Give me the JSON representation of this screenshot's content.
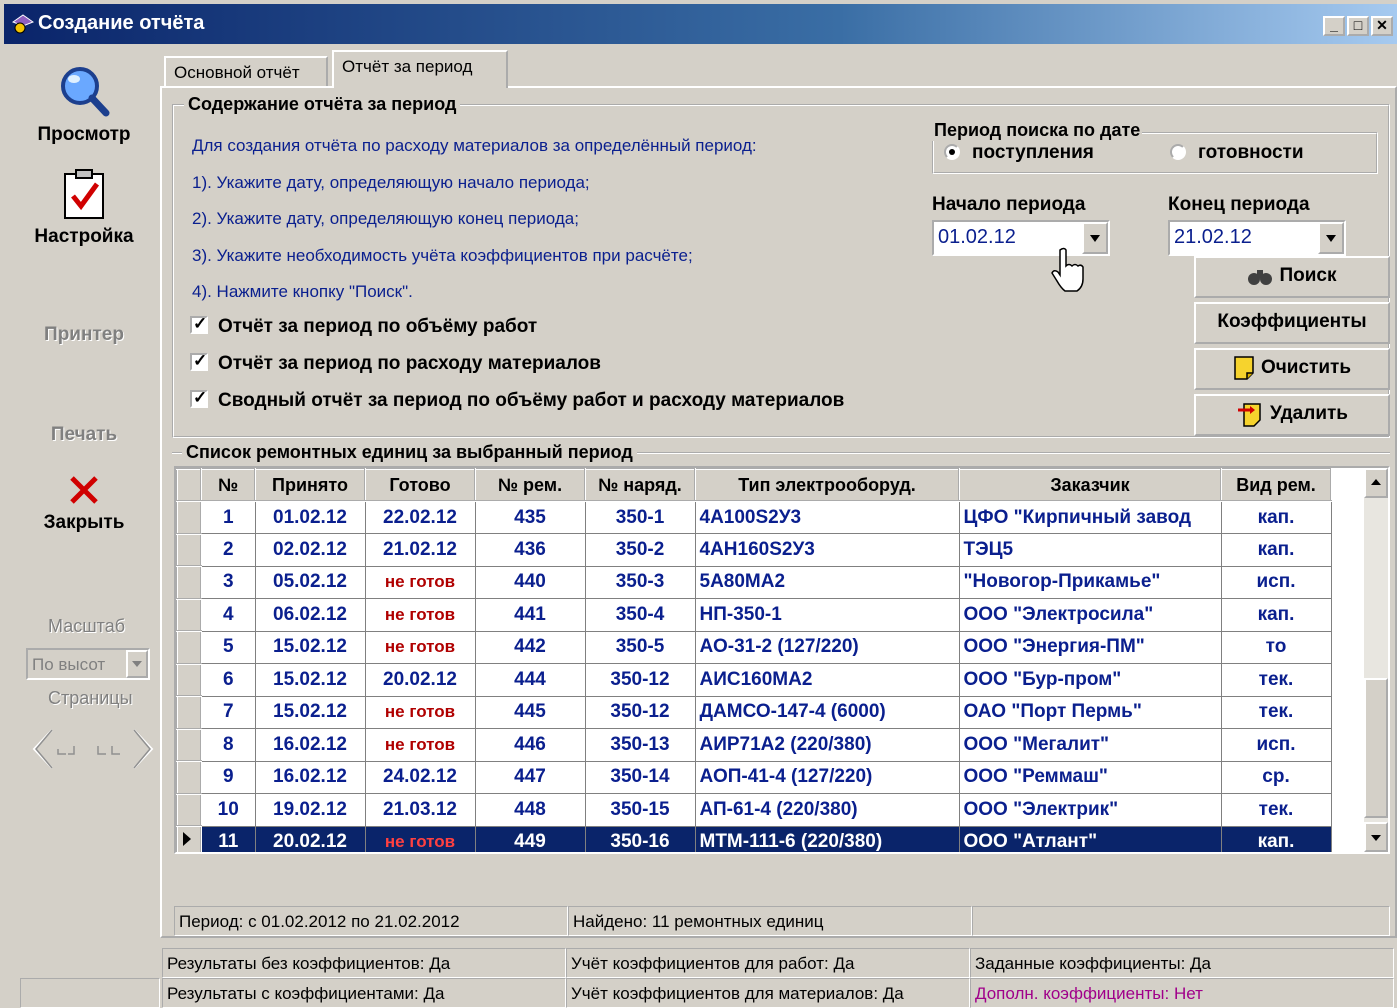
{
  "window": {
    "title": "Создание отчёта"
  },
  "left_toolbar": {
    "view": "Просмотр",
    "settings": "Настройка",
    "printer": "Принтер",
    "print": "Печать",
    "close": "Закрыть",
    "scale_label": "Масштаб",
    "scale_value": "По высот",
    "pages_label": "Страницы"
  },
  "tabs": [
    "Основной отчёт",
    "Отчёт за период"
  ],
  "content_group": {
    "title": "Содержание отчёта за период",
    "instructions": [
      "Для создания отчёта по расходу материалов за определённый период:",
      "1). Укажите дату, определяющую начало периода;",
      "2). Укажите дату, определяющую конец периода;",
      "3). Укажите необходимость учёта коэффициентов при расчёте;",
      "4). Нажмите кнопку \"Поиск\"."
    ],
    "checkboxes": [
      {
        "label": "Отчёт за период по объёму работ",
        "checked": true
      },
      {
        "label": "Отчёт за период по расходу материалов",
        "checked": true
      },
      {
        "label": "Сводный отчёт за период по объёму работ и расходу материалов",
        "checked": true
      }
    ]
  },
  "period_group": {
    "title": "Период поиска по дате",
    "radio_receipt": "поступления",
    "radio_ready": "готовности",
    "selected": "поступления"
  },
  "start_label": "Начало периода",
  "start_value": "01.02.12",
  "end_label": "Конец периода",
  "end_value": "21.02.12",
  "buttons": {
    "search": "Поиск",
    "coefficients": "Коэффициенты",
    "clear": "Очистить",
    "delete": "Удалить"
  },
  "list_group": {
    "title": "Список ремонтных единиц за выбранный период"
  },
  "table": {
    "columns": [
      "№",
      "Принято",
      "Готово",
      "№ рем.",
      "№ наряд.",
      "Тип электрооборуд.",
      "Заказчик",
      "Вид рем."
    ],
    "rows": [
      [
        "1",
        "01.02.12",
        "22.02.12",
        "435",
        "350-1",
        "4А100S2У3",
        "ЦФО \"Кирпичный завод",
        "кап."
      ],
      [
        "2",
        "02.02.12",
        "21.02.12",
        "436",
        "350-2",
        "4АН160S2У3",
        "ТЭЦ5",
        "кап."
      ],
      [
        "3",
        "05.02.12",
        "не готов",
        "440",
        "350-3",
        "5А80МА2",
        "\"Новогор-Прикамье\"",
        "исп."
      ],
      [
        "4",
        "06.02.12",
        "не готов",
        "441",
        "350-4",
        "НП-350-1",
        "ООО \"Электросила\"",
        "кап."
      ],
      [
        "5",
        "15.02.12",
        "не готов",
        "442",
        "350-5",
        "АО-31-2 (127/220)",
        "ООО \"Энергия-ПМ\"",
        "то"
      ],
      [
        "6",
        "15.02.12",
        "20.02.12",
        "444",
        "350-12",
        "АИС160МА2",
        "ООО \"Бур-пром\"",
        "тек."
      ],
      [
        "7",
        "15.02.12",
        "не готов",
        "445",
        "350-12",
        "ДАМСО-147-4 (6000)",
        "ОАО \"Порт Пермь\"",
        "тек."
      ],
      [
        "8",
        "16.02.12",
        "не готов",
        "446",
        "350-13",
        "АИР71А2 (220/380)",
        "ООО \"Мегалит\"",
        "исп."
      ],
      [
        "9",
        "16.02.12",
        "24.02.12",
        "447",
        "350-14",
        "АОП-41-4 (127/220)",
        "ООО \"Реммаш\"",
        "ср."
      ],
      [
        "10",
        "19.02.12",
        "21.03.12",
        "448",
        "350-15",
        "АП-61-4 (220/380)",
        "ООО \"Электрик\"",
        "тек."
      ],
      [
        "11",
        "20.02.12",
        "не готов",
        "449",
        "350-16",
        "МТМ-111-6 (220/380)",
        "ООО \"Атлант\"",
        "кап."
      ]
    ],
    "selected_row": 10,
    "not_ready_text": "не готов"
  },
  "grid_status": {
    "period": "Период: с 01.02.2012 по 21.02.2012",
    "found": "Найдено: 11 ремонтных единиц"
  },
  "status": {
    "no_coef": "Результаты без коэффициентов: Да",
    "with_coef": "Результаты с коэффициентами: Да",
    "coef_works": "Учёт коэффициентов для работ: Да",
    "coef_materials": "Учёт коэффициентов для материалов: Да",
    "coef_set": "Заданные коэффициенты: Да",
    "coef_extra": "Дополн. коэффициенты: Нет"
  },
  "colors": {
    "link_blue": "#0a1f8e",
    "not_ready": "#b00000",
    "selection": "#0a246a",
    "extra_coef": "#a0008a"
  }
}
